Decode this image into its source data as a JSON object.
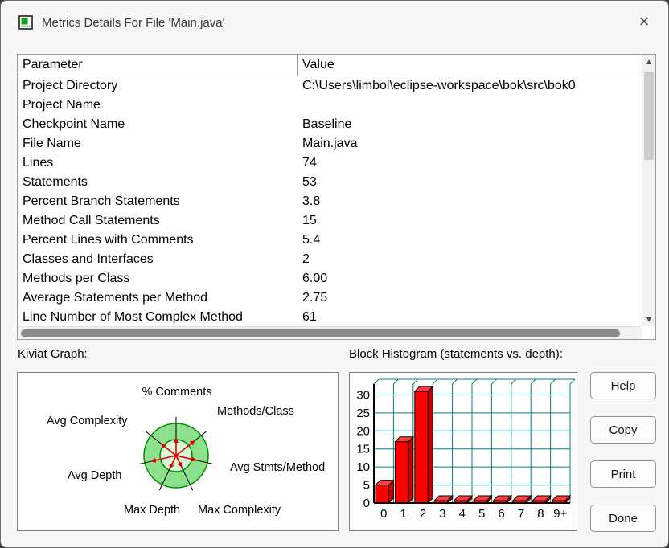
{
  "window": {
    "title": "Metrics Details For File 'Main.java'"
  },
  "icons": {
    "close": "×",
    "scroll_up": "▲",
    "scroll_down": "▼"
  },
  "table": {
    "columns": [
      "Parameter",
      "Value"
    ],
    "rows": [
      {
        "param": "Project Directory",
        "value": "C:\\Users\\limbol\\eclipse-workspace\\bok\\src\\bok0"
      },
      {
        "param": "Project Name",
        "value": ""
      },
      {
        "param": "Checkpoint Name",
        "value": "Baseline"
      },
      {
        "param": "File Name",
        "value": "Main.java"
      },
      {
        "param": "Lines",
        "value": "74"
      },
      {
        "param": "Statements",
        "value": "53"
      },
      {
        "param": "Percent Branch Statements",
        "value": "3.8"
      },
      {
        "param": "Method Call Statements",
        "value": "15"
      },
      {
        "param": "Percent Lines with Comments",
        "value": "5.4"
      },
      {
        "param": "Classes and Interfaces",
        "value": "2"
      },
      {
        "param": "Methods per Class",
        "value": "6.00"
      },
      {
        "param": "Average Statements per Method",
        "value": "2.75"
      },
      {
        "param": "Line Number of Most Complex Method",
        "value": "61"
      }
    ]
  },
  "sections": {
    "kiviat": "Kiviat Graph:",
    "histogram": "Block Histogram (statements vs. depth):"
  },
  "buttons": {
    "help": "Help",
    "copy": "Copy",
    "print": "Print",
    "done": "Done"
  },
  "chart_data": [
    {
      "type": "radar",
      "title": "Kiviat Graph",
      "axes": [
        "% Comments",
        "Methods/Class",
        "Avg Stmts/Method",
        "Max Complexity",
        "Max Depth",
        "Avg Depth",
        "Avg Complexity"
      ],
      "values": [
        0.55,
        0.75,
        0.65,
        0.4,
        0.45,
        0.8,
        0.6
      ],
      "values_note": "red arrow lengths estimated as fraction of outer ring radius",
      "ring_fill": "#8CE08C",
      "ring_stroke": "#009000",
      "inner_fill": "#D9F7D9",
      "arrow_color": "#E00000"
    },
    {
      "type": "bar",
      "title": "Block Histogram (statements vs. depth)",
      "categories": [
        "0",
        "1",
        "2",
        "3",
        "4",
        "5",
        "6",
        "7",
        "8",
        "9+"
      ],
      "values": [
        5,
        17,
        31,
        0,
        0,
        0,
        0,
        0,
        0,
        0
      ],
      "xlabel": "depth",
      "ylabel": "statements",
      "ylim": [
        0,
        33
      ],
      "ytick_step": 5,
      "grid": true,
      "style": "3d",
      "bar_color": "#FF0000",
      "bar_top_color": "#FF4040",
      "bar_side_color": "#C40000",
      "grid_color": "#008080"
    }
  ]
}
